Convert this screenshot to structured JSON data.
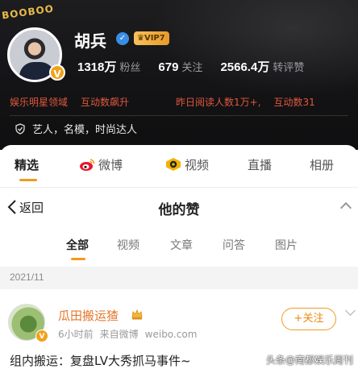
{
  "profile": {
    "deco_text": "BOOBOO",
    "name": "胡兵",
    "vip_label": "VIP7",
    "avatar_badge": "V",
    "stats": [
      {
        "value": "1318万",
        "label": "粉丝"
      },
      {
        "value": "679",
        "label": "关注"
      },
      {
        "value": "2566.4万",
        "label": "转评赞"
      }
    ],
    "tags": {
      "domain": "娱乐明星领域",
      "growth": "互动数飙升",
      "read": "昨日阅读人数1万+,",
      "interact": "互动数31"
    },
    "intro": "艺人，名模，时尚达人"
  },
  "profile_tabs": [
    {
      "label": "精选"
    },
    {
      "label": "微博"
    },
    {
      "label": "视频"
    },
    {
      "label": "直播"
    },
    {
      "label": "相册"
    }
  ],
  "liked_page": {
    "back_label": "返回",
    "title": "他的赞"
  },
  "filter_tabs": [
    {
      "label": "全部"
    },
    {
      "label": "视频"
    },
    {
      "label": "文章"
    },
    {
      "label": "问答"
    },
    {
      "label": "图片"
    }
  ],
  "date_group": "2021/11",
  "post": {
    "author": "瓜田搬运猹",
    "time": "6小时前",
    "source": "来自微博",
    "domain": "weibo.com",
    "follow_label": "+关注",
    "avatar_badge": "V",
    "text": "组内搬运：复盘LV大秀抓马事件~"
  },
  "watermark": "头条@南都娱乐周刊",
  "colors": {
    "accent": "#f09b1f",
    "tag_red": "#e0573c",
    "author_orange": "#e4772a",
    "header_bg": "#141416"
  },
  "icons": [
    "verified-icon",
    "shield-icon",
    "weibo-icon",
    "video-icon",
    "back-icon",
    "crown-icon",
    "chevron-down-icon"
  ]
}
